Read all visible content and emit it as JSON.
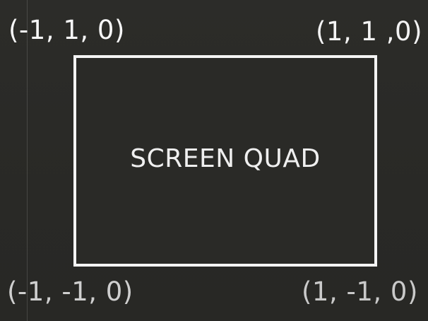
{
  "diagram": {
    "quad_label": "SCREEN QUAD",
    "corners": {
      "top_left": "(-1, 1, 0)",
      "top_right": "(1, 1 ,0)",
      "bottom_left": "(-1, -1, 0)",
      "bottom_right": "(1, -1, 0)"
    }
  },
  "colors": {
    "background": "#2a2a27",
    "stroke": "#f4f4f4",
    "text": "#f2f2f2"
  }
}
